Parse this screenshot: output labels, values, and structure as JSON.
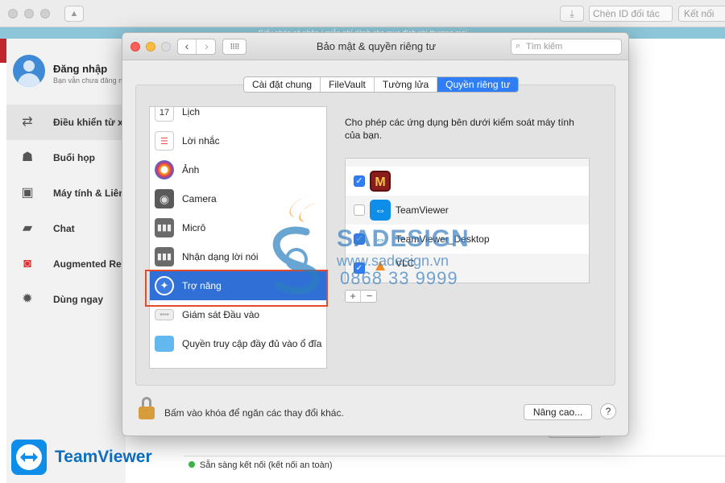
{
  "teamviewer": {
    "id_placeholder": "Chèn ID đối tác",
    "connect_label": "Kết nối",
    "banner_text": "Giấy phép cá nhân / miễn phí dành cho mục đích phi thương mại",
    "profile": {
      "name": "Đăng nhập",
      "subtitle": "Bạn vẫn chưa đăng nhập"
    },
    "nav": [
      {
        "label": "Điều khiển từ xa",
        "icon": "arrows-icon"
      },
      {
        "label": "Buổi họp",
        "icon": "group-icon"
      },
      {
        "label": "Máy tính & Liên lạc",
        "icon": "contacts-icon"
      },
      {
        "label": "Chat",
        "icon": "chat-icon"
      },
      {
        "label": "Augmented Reality",
        "icon": "ar-icon"
      },
      {
        "label": "Dùng ngay",
        "icon": "bulb-icon"
      }
    ],
    "logo_text": "TeamViewer",
    "status": "Sẵn sàng kết nối (kết nối an toàn)"
  },
  "prefs": {
    "title": "Bảo mật & quyền riêng tư",
    "search_placeholder": "Tìm kiếm",
    "tabs": [
      "Cài đặt chung",
      "FileVault",
      "Tường lửa",
      "Quyền riêng tư"
    ],
    "active_tab": "Quyền riêng tư",
    "categories": [
      {
        "label": "Lịch",
        "icon": "calendar-icon"
      },
      {
        "label": "Lời nhắc",
        "icon": "reminders-icon"
      },
      {
        "label": "Ảnh",
        "icon": "photos-icon"
      },
      {
        "label": "Camera",
        "icon": "camera-icon"
      },
      {
        "label": "Micrô",
        "icon": "microphone-icon"
      },
      {
        "label": "Nhận dạng lời nói",
        "icon": "speech-icon"
      },
      {
        "label": "Trợ năng",
        "icon": "accessibility-icon"
      },
      {
        "label": "Giám sát Đầu vào",
        "icon": "keyboard-icon"
      },
      {
        "label": "Quyền truy cập đầy đủ vào ổ đĩa",
        "icon": "folder-icon"
      }
    ],
    "selected_category": "Trợ năng",
    "description": "Cho phép các ứng dụng bên dưới kiểm soát máy tính của bạn.",
    "apps": [
      {
        "name": "",
        "checked": true,
        "icon": "m-app-icon"
      },
      {
        "name": "TeamViewer",
        "checked": false,
        "icon": "teamviewer-icon"
      },
      {
        "name": "TeamViewer_Desktop",
        "checked": true,
        "icon": "teamviewer-desktop-icon"
      },
      {
        "name": "VLC",
        "checked": true,
        "icon": "vlc-icon"
      }
    ],
    "add_label": "+",
    "remove_label": "−",
    "lock_text": "Bấm vào khóa để ngăn các thay đổi khác.",
    "advanced_label": "Nâng cao...",
    "help_label": "?"
  },
  "watermark": {
    "name": "SADESIGN",
    "url": "www.sadesign.vn",
    "phone": "0868 33 9999"
  },
  "colors": {
    "accent": "#2f7ef6",
    "selection": "#2f6fd6",
    "highlight_box": "#e24a2a",
    "teamviewer_blue": "#0e8ee9"
  }
}
